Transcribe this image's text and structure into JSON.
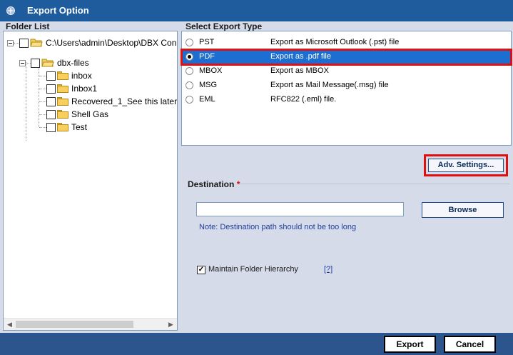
{
  "window": {
    "title": "Export Option",
    "icon": "app-icon"
  },
  "folder_list": {
    "label": "Folder List",
    "root": {
      "path": "C:\\Users\\admin\\Desktop\\DBX Con",
      "icon": "folder-open-icon"
    },
    "child": {
      "name": "dbx-files",
      "icon": "folder-open-icon"
    },
    "items": [
      {
        "name": "inbox"
      },
      {
        "name": "Inbox1"
      },
      {
        "name": "Recovered_1_See this later"
      },
      {
        "name": "Shell Gas"
      },
      {
        "name": "Test"
      }
    ]
  },
  "export_type": {
    "label": "Select Export Type",
    "options": [
      {
        "name": "PST",
        "description": "Export as Microsoft Outlook (.pst) file",
        "selected": false
      },
      {
        "name": "PDF",
        "description": "Export as .pdf file",
        "selected": true
      },
      {
        "name": "MBOX",
        "description": "Export as MBOX",
        "selected": false
      },
      {
        "name": "MSG",
        "description": "Export as Mail Message(.msg) file",
        "selected": false
      },
      {
        "name": "EML",
        "description": "RFC822 (.eml) file.",
        "selected": false
      }
    ]
  },
  "adv_settings_label": "Adv. Settings...",
  "destination": {
    "label": "Destination",
    "required_marker": "*",
    "value": "",
    "browse_label": "Browse",
    "note": "Note: Destination path should not be too long"
  },
  "hierarchy": {
    "label": "Maintain Folder Hierarchy",
    "checked": true,
    "help": "[?]"
  },
  "footer": {
    "export_label": "Export",
    "cancel_label": "Cancel"
  },
  "colors": {
    "title_bar": "#1f5c9e",
    "selection": "#1c6fd1",
    "highlight_border": "#e01010",
    "bottom_bar": "#2b558c"
  }
}
